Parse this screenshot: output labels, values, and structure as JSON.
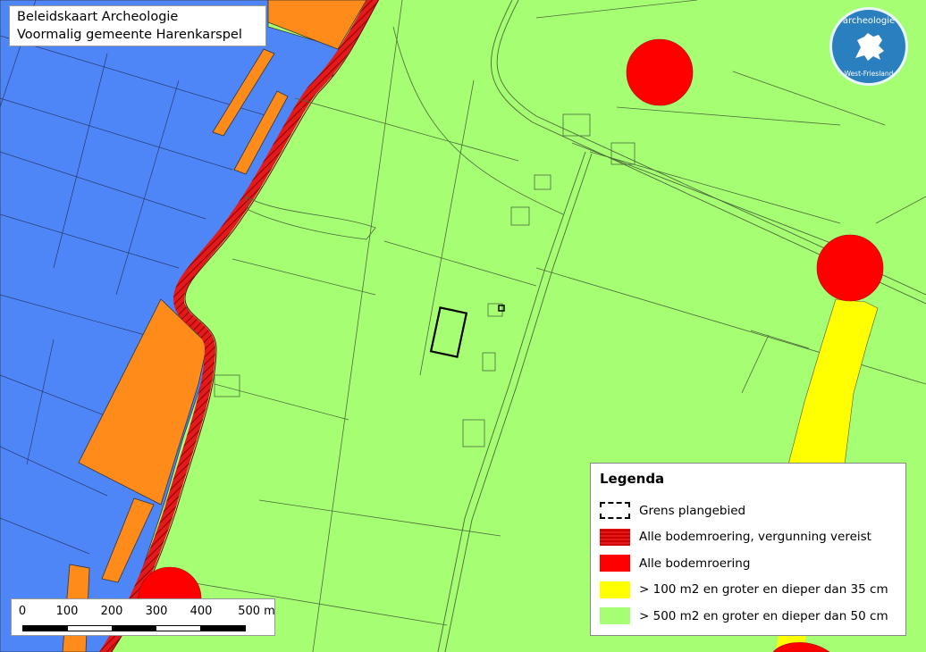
{
  "title": {
    "line1": "Beleidskaart Archeologie",
    "line2": "Voormalig gemeente Harenkarspel"
  },
  "legend": {
    "heading": "Legenda",
    "items": [
      {
        "label": "Grens plangebied",
        "style": "dashed-outline",
        "color": "#000000"
      },
      {
        "label": "Alle bodemroering, vergunning vereist",
        "style": "hatched",
        "color": "#cc0000"
      },
      {
        "label": "Alle bodemroering",
        "style": "solid",
        "color": "#ff0000"
      },
      {
        "label": "> 100 m2 en groter en dieper dan 35 cm",
        "style": "solid",
        "color": "#ffff00"
      },
      {
        "label": "> 500 m2 en groter en dieper dan 50 cm",
        "style": "solid",
        "color": "#a6ff73"
      }
    ]
  },
  "scalebar": {
    "ticks": [
      "0",
      "100",
      "200",
      "300",
      "400",
      "500 m"
    ]
  },
  "logo": {
    "top_text": "archeologie",
    "bottom_text": "West-Friesland",
    "icon": "lion-emblem-icon"
  },
  "colors": {
    "water_blue": "#4f86f7",
    "orange_zone": "#ff8c1a",
    "red_zone": "#ff0000",
    "yellow_zone": "#ffff00",
    "green_zone": "#a6ff73"
  }
}
